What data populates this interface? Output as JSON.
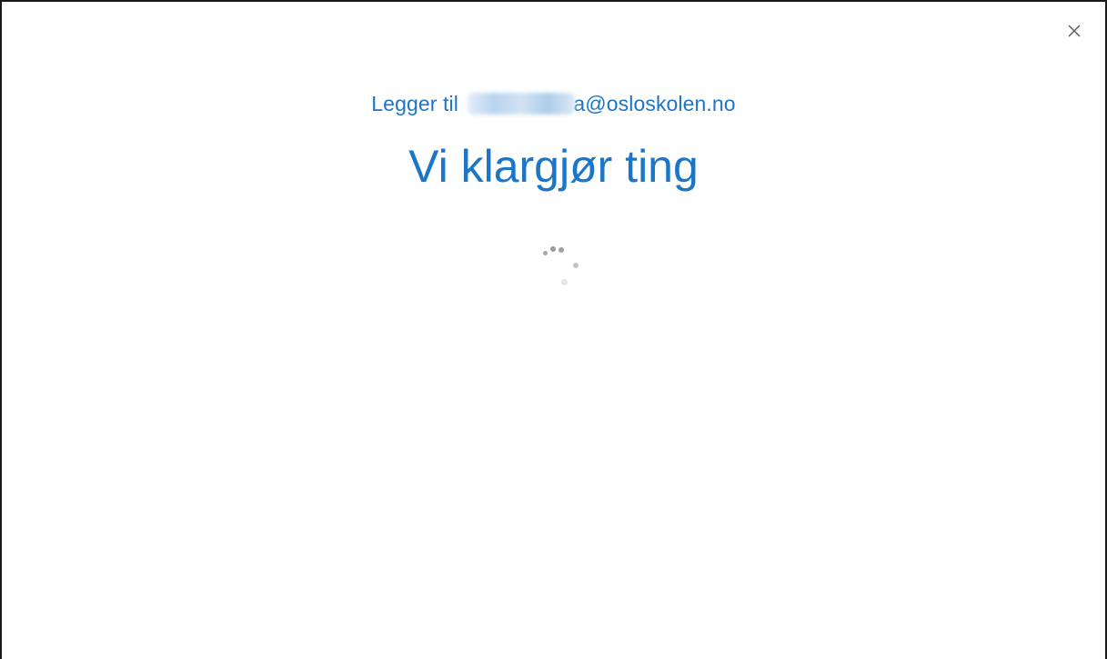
{
  "dialog": {
    "close_icon": "close-icon",
    "adding_prefix": "Legger til",
    "email_visible_suffix": "a@osloskolen.no",
    "heading": "Vi klargjør ting",
    "loading_icon": "loading-spinner-icon"
  },
  "colors": {
    "accent": "#1c76c8",
    "spinner": "#9a9a9a",
    "close": "#555555"
  }
}
